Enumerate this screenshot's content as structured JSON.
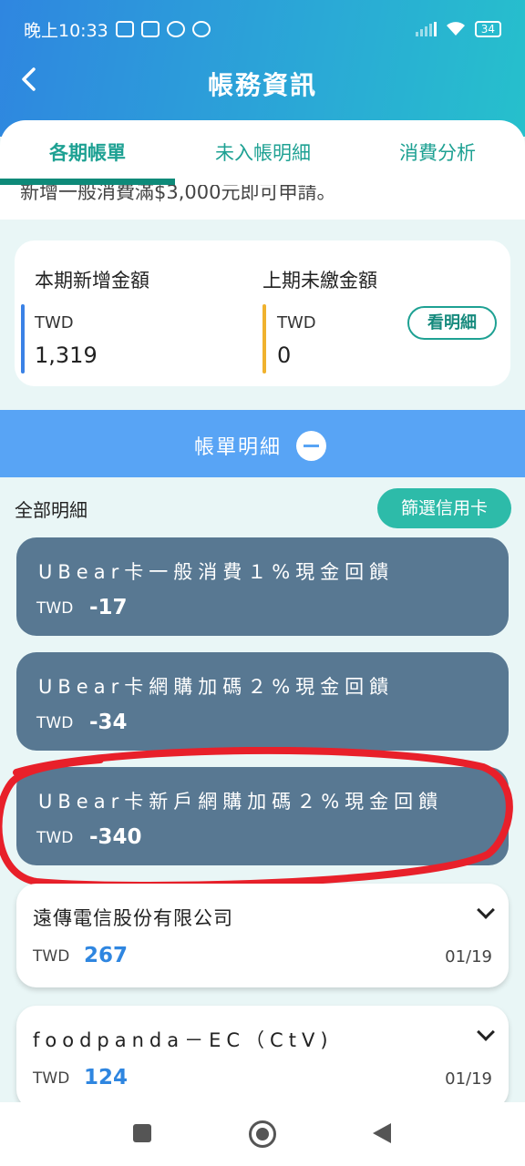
{
  "status_bar": {
    "time": "晚上10:33",
    "battery": "34"
  },
  "header": {
    "title": "帳務資訊"
  },
  "tabs": [
    {
      "label": "各期帳單",
      "active": true
    },
    {
      "label": "未入帳明細",
      "active": false
    },
    {
      "label": "消費分析",
      "active": false
    }
  ],
  "cut_text": "新增一般消費滿$3,000元即可申請。",
  "summary": {
    "new_label": "本期新增金額",
    "new_currency": "TWD",
    "new_value": "1,319",
    "unpaid_label": "上期未繳金額",
    "unpaid_currency": "TWD",
    "unpaid_value": "0",
    "detail_button": "看明細"
  },
  "bill_detail": {
    "label": "帳單明細"
  },
  "list": {
    "section_label": "全部明細",
    "filter_button": "篩選信用卡",
    "items": [
      {
        "title": "UBear卡一般消費１%現金回饋",
        "currency": "TWD",
        "amount": "-17"
      },
      {
        "title": "UBear卡網購加碼２%現金回饋",
        "currency": "TWD",
        "amount": "-34"
      },
      {
        "title": "UBear卡新戶網購加碼２%現金回饋",
        "currency": "TWD",
        "amount": "-340"
      },
      {
        "title": "遠傳電信股份有限公司",
        "currency": "TWD",
        "amount": "267",
        "date": "01/19"
      },
      {
        "title": "foodpanda－EC（CtV)",
        "currency": "TWD",
        "amount": "124",
        "date": "01/19"
      }
    ]
  },
  "colors": {
    "accent": "#1ea193",
    "header_start": "#2f86e0",
    "header_end": "#26c0cc",
    "dark_card": "#587892",
    "annotation": "#e8202a"
  }
}
